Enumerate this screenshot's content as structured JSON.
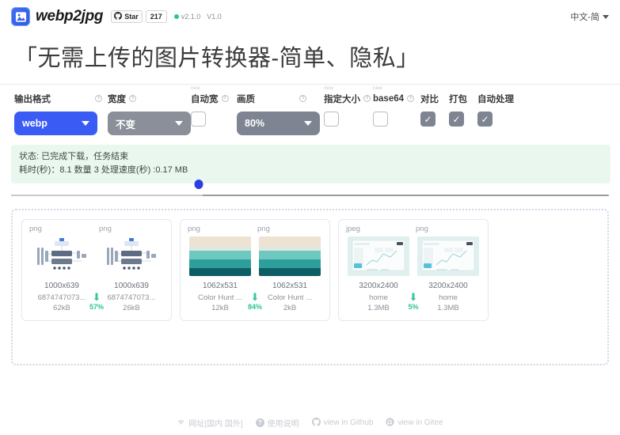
{
  "header": {
    "logo_icon": "image-mountain-icon",
    "brand": "webp2jpg",
    "github_star_label": "Star",
    "github_star_count": "217",
    "version": "v2.1.0",
    "version_alt": "V1.0",
    "language": "中文-简",
    "accent_color": "#3b5bf5",
    "status_dot_color": "#2fc48d"
  },
  "page_title": "「无需上传的图片转换器-简单、隐私」",
  "controls": [
    {
      "label": "输出格式",
      "new": "",
      "type": "select",
      "value": "webp",
      "style": "blue",
      "has_help": true,
      "help_far": true
    },
    {
      "label": "宽度",
      "new": "",
      "type": "select",
      "value": "不变",
      "style": "gray",
      "has_help": true,
      "help_far": false
    },
    {
      "label": "自动宽",
      "new": "new",
      "type": "checkbox",
      "checked": false,
      "has_help": true,
      "help_far": false
    },
    {
      "label": "画质",
      "new": "",
      "type": "select",
      "value": "80%",
      "style": "gray-q",
      "has_help": true,
      "help_far": true
    },
    {
      "label": "指定大小",
      "new": "new",
      "type": "checkbox",
      "checked": false,
      "has_help": true,
      "help_far": false
    },
    {
      "label": "base64",
      "new": "new",
      "type": "checkbox",
      "checked": false,
      "has_help": true,
      "help_far": false
    },
    {
      "label": "对比",
      "new": "",
      "type": "checkbox",
      "checked": true,
      "has_help": false,
      "help_far": false
    },
    {
      "label": "打包",
      "new": "",
      "type": "checkbox",
      "checked": true,
      "has_help": false,
      "help_far": false
    },
    {
      "label": "自动处理",
      "new": "",
      "type": "checkbox",
      "checked": true,
      "has_help": false,
      "help_far": false
    }
  ],
  "status": {
    "line1": "状态: 已完成下载，任务结束",
    "line2": "耗时(秒)：8.1 数量 3 处理速度(秒) :0.17 MB",
    "background": "#eaf7ef"
  },
  "slider": {
    "value_percent": 32
  },
  "results": [
    {
      "source": {
        "format": "png",
        "dimensions": "1000x639",
        "name": "6874747073...",
        "size": "62kB"
      },
      "target": {
        "format": "png",
        "dimensions": "1000x639",
        "name": "6874747073...",
        "size": "26kB"
      },
      "reduction": "57%",
      "thumb": "network-diagram"
    },
    {
      "source": {
        "format": "png",
        "dimensions": "1062x531",
        "name": "Color Hunt ...",
        "size": "12kB"
      },
      "target": {
        "format": "png",
        "dimensions": "1062x531",
        "name": "Color Hunt ...",
        "size": "2kB"
      },
      "reduction": "84%",
      "thumb": "color-palette"
    },
    {
      "source": {
        "format": "jpeg",
        "dimensions": "3200x2400",
        "name": "home",
        "size": "1.3MB"
      },
      "target": {
        "format": "png",
        "dimensions": "3200x2400",
        "name": "home",
        "size": "1.3MB"
      },
      "reduction": "5%",
      "thumb": "dashboard-screenshot"
    }
  ],
  "footer": [
    {
      "icon": "wifi-icon",
      "label": "网址[国内 国外]"
    },
    {
      "icon": "question-icon",
      "label": "使用说明"
    },
    {
      "icon": "github-icon",
      "label": "view in Github"
    },
    {
      "icon": "gitee-icon",
      "label": "view in Gitee"
    }
  ]
}
